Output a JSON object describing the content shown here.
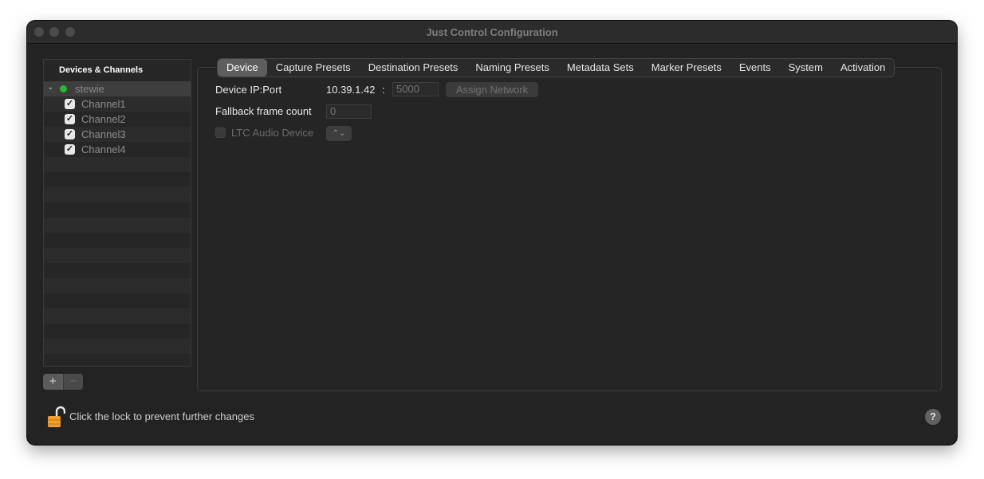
{
  "window": {
    "title": "Just Control Configuration"
  },
  "sidebar": {
    "header": "Devices & Channels",
    "device": {
      "name": "stewie",
      "status_color": "#2bb63a"
    },
    "channels": [
      {
        "label": "Channel1",
        "checked": true
      },
      {
        "label": "Channel2",
        "checked": true
      },
      {
        "label": "Channel3",
        "checked": true
      },
      {
        "label": "Channel4",
        "checked": true
      }
    ],
    "add_label": "+",
    "remove_label": "−"
  },
  "tabs": [
    {
      "label": "Device",
      "active": true
    },
    {
      "label": "Capture Presets"
    },
    {
      "label": "Destination Presets"
    },
    {
      "label": "Naming Presets"
    },
    {
      "label": "Metadata Sets"
    },
    {
      "label": "Marker Presets"
    },
    {
      "label": "Events"
    },
    {
      "label": "System"
    },
    {
      "label": "Activation"
    }
  ],
  "device": {
    "ip_label": "Device IP:Port",
    "ip_value": "10.39.1.42",
    "separator": ":",
    "port_placeholder": "5000",
    "assign_label": "Assign Network",
    "fallback_label": "Fallback frame count",
    "fallback_placeholder": "0",
    "ltc_label": "LTC Audio Device",
    "ltc_popup_glyph": "⌃⌄"
  },
  "footer": {
    "lock_text": "Click the lock to prevent further changes",
    "help_label": "?"
  },
  "colors": {
    "accent": "#2bb63a",
    "lock": "#f0a030"
  }
}
